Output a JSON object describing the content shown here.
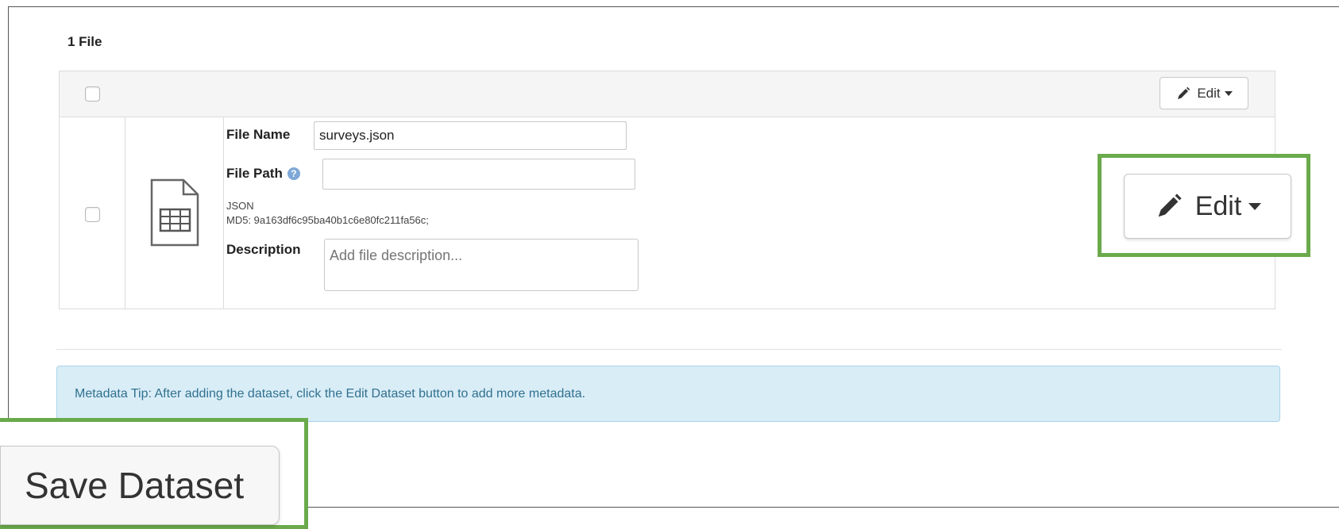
{
  "header": {
    "file_count": "1 File"
  },
  "table": {
    "toolbar": {
      "edit_label": "Edit"
    },
    "row": {
      "file_icon": "spreadsheet-file-icon",
      "file_name_label": "File Name",
      "file_name_value": "surveys.json",
      "file_path_label": "File Path",
      "file_path_value": "",
      "file_type": "JSON",
      "md5": "MD5: 9a163df6c95ba40b1c6e80fc211fa56c;",
      "description_label": "Description",
      "description_placeholder": "Add file description..."
    }
  },
  "tip": {
    "text": "Metadata Tip: After adding the dataset, click the Edit Dataset button to add more metadata."
  },
  "callouts": {
    "edit_label": "Edit",
    "save_label": "Save Dataset",
    "highlight_color": "#6aaa4b"
  },
  "colors": {
    "tip_background": "#d9edf7",
    "tip_text": "#31708f"
  }
}
